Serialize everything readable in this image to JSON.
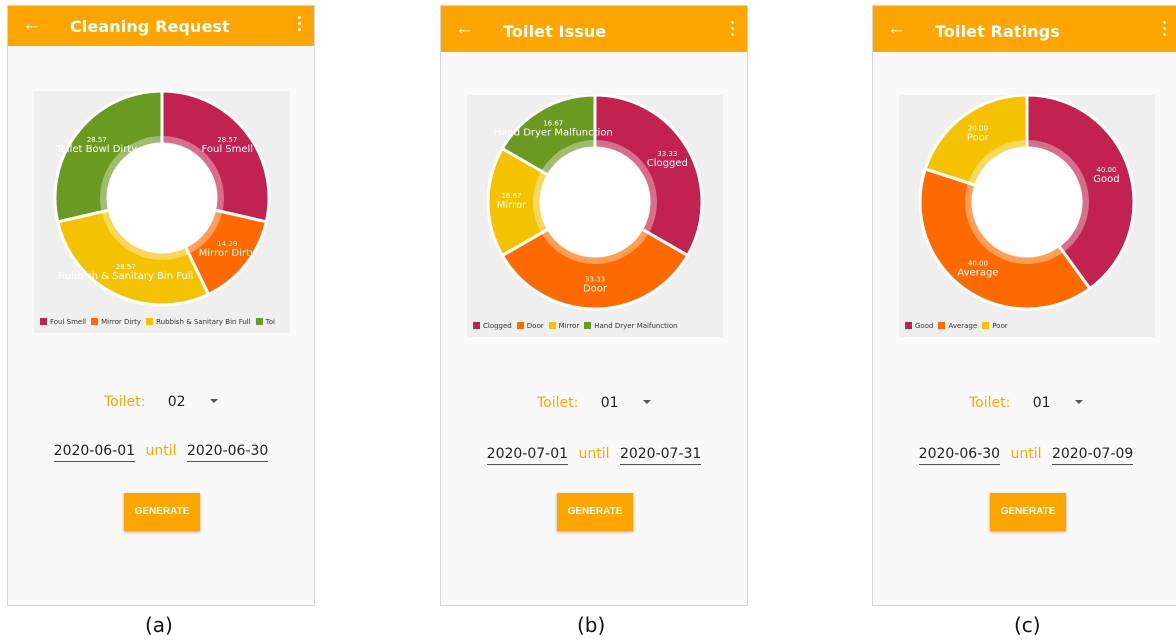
{
  "colors": {
    "accent": "#ffa502",
    "crimson": "#c2224f",
    "orange": "#ff6a00",
    "yellow": "#f4c200",
    "green": "#6a9a22"
  },
  "icons": {
    "back": "arrow-left-icon",
    "menu": "more-vertical-icon",
    "dropdown": "caret-down-icon"
  },
  "screens": [
    {
      "title": "Cleaning Request",
      "toilet_label": "Toilet:",
      "toilet_value": "02",
      "date_from": "2020-06-01",
      "until_label": "until",
      "date_to": "2020-06-30",
      "generate_label": "GENERATE",
      "caption": "(a)",
      "chart_data": {
        "type": "pie",
        "slices": [
          {
            "label": "Foul Smell",
            "value": 28.57,
            "value_text": "28.57",
            "color": "#c2224f"
          },
          {
            "label": "Mirror Dirty",
            "value": 14.29,
            "value_text": "14.29",
            "color": "#ff6a00"
          },
          {
            "label": "Rubbish & Sanitary Bin Full",
            "value": 28.57,
            "value_text": "28.57",
            "color": "#f4c200"
          },
          {
            "label": "Toilet Bowl Dirty",
            "value": 28.57,
            "value_text": "28.57",
            "color": "#6a9a22"
          }
        ],
        "legend": [
          "Foul Smell",
          "Mirror Dirty",
          "Rubbish & Sanitary Bin Full",
          "Toi"
        ]
      }
    },
    {
      "title": "Toilet Issue",
      "toilet_label": "Toilet:",
      "toilet_value": "01",
      "date_from": "2020-07-01",
      "until_label": "until",
      "date_to": "2020-07-31",
      "generate_label": "GENERATE",
      "caption": "(b)",
      "chart_data": {
        "type": "pie",
        "slices": [
          {
            "label": "Clogged",
            "value": 33.33,
            "value_text": "33.33",
            "color": "#c2224f"
          },
          {
            "label": "Door",
            "value": 33.33,
            "value_text": "33.33",
            "color": "#ff6a00"
          },
          {
            "label": "Mirror",
            "value": 16.67,
            "value_text": "16.67",
            "color": "#f4c200"
          },
          {
            "label": "Hand Dryer Malfunction",
            "value": 16.67,
            "value_text": "16.67",
            "color": "#6a9a22"
          }
        ],
        "legend": [
          "Clogged",
          "Door",
          "Mirror",
          "Hand Dryer Malfunction"
        ]
      }
    },
    {
      "title": "Toilet Ratings",
      "toilet_label": "Toilet:",
      "toilet_value": "01",
      "date_from": "2020-06-30",
      "until_label": "until",
      "date_to": "2020-07-09",
      "generate_label": "GENERATE",
      "caption": "(c)",
      "chart_data": {
        "type": "pie",
        "slices": [
          {
            "label": "Good",
            "value": 40.0,
            "value_text": "40.00",
            "color": "#c2224f"
          },
          {
            "label": "Average",
            "value": 40.0,
            "value_text": "40.00",
            "color": "#ff6a00"
          },
          {
            "label": "Poor",
            "value": 20.0,
            "value_text": "20.00",
            "color": "#f4c200"
          }
        ],
        "legend": [
          "Good",
          "Average",
          "Poor"
        ]
      }
    }
  ]
}
